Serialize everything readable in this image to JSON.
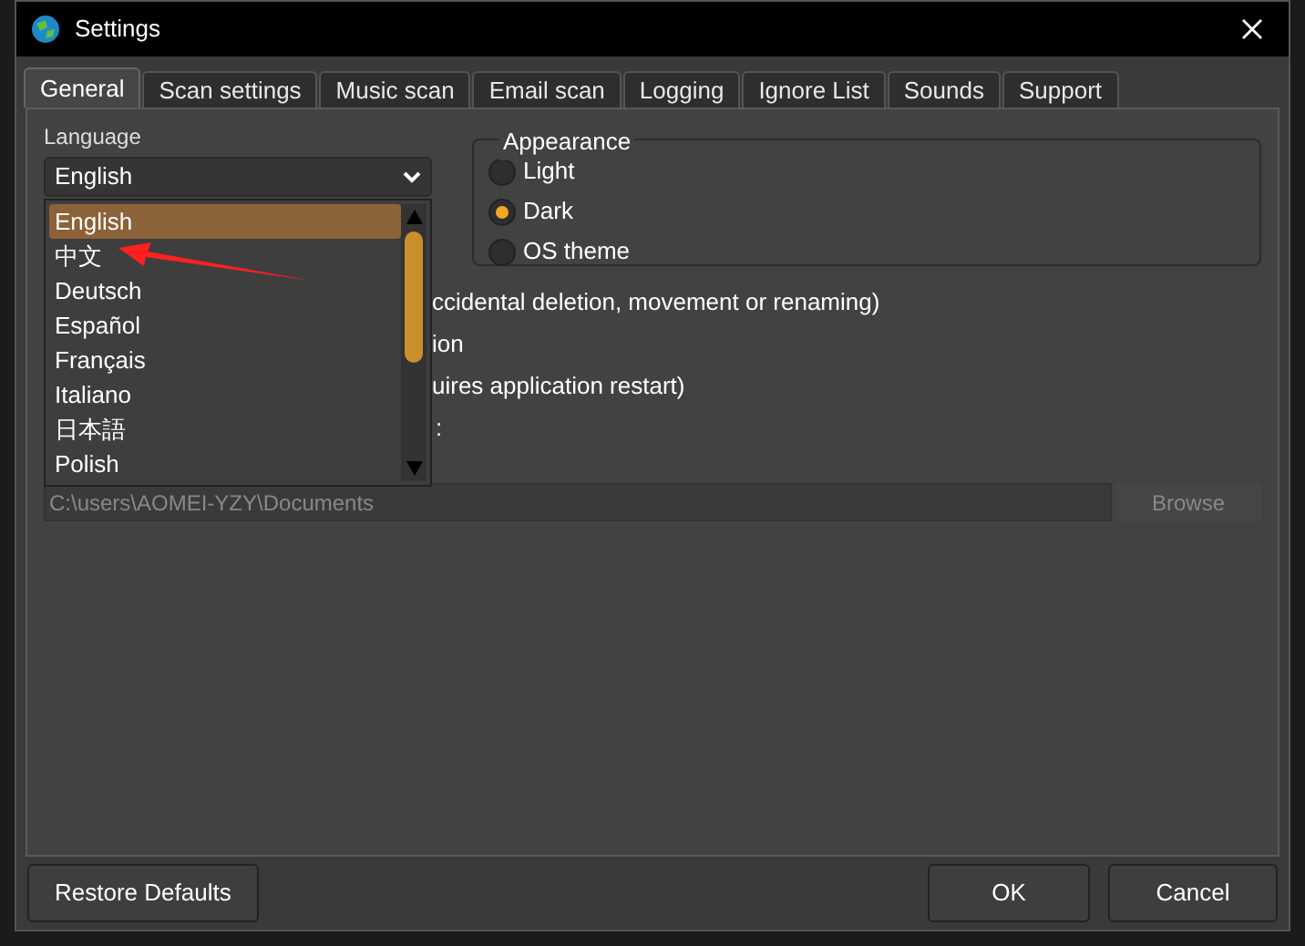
{
  "window": {
    "title": "Settings"
  },
  "tabs": [
    {
      "label": "General",
      "selected": true
    },
    {
      "label": "Scan settings",
      "selected": false
    },
    {
      "label": "Music scan",
      "selected": false
    },
    {
      "label": "Email scan",
      "selected": false
    },
    {
      "label": "Logging",
      "selected": false
    },
    {
      "label": "Ignore List",
      "selected": false
    },
    {
      "label": "Sounds",
      "selected": false
    },
    {
      "label": "Support",
      "selected": false
    }
  ],
  "language": {
    "label": "Language",
    "value": "English",
    "options": [
      {
        "label": "English",
        "selected": true
      },
      {
        "label": "中文",
        "selected": false
      },
      {
        "label": "Deutsch",
        "selected": false
      },
      {
        "label": "Español",
        "selected": false
      },
      {
        "label": "Français",
        "selected": false
      },
      {
        "label": "Italiano",
        "selected": false
      },
      {
        "label": "日本語",
        "selected": false
      },
      {
        "label": "Polish",
        "selected": false
      }
    ]
  },
  "appearance": {
    "title": "Appearance",
    "options": [
      {
        "label": "Light",
        "selected": false
      },
      {
        "label": "Dark",
        "selected": true
      },
      {
        "label": "OS theme",
        "selected": false
      }
    ]
  },
  "options": [
    "ccidental deletion, movement or renaming)",
    "ion",
    "uires application restart)"
  ],
  "folder": {
    "label": ":",
    "value": "C:\\users\\AOMEI-YZY\\Documents",
    "browse": "Browse"
  },
  "buttons": {
    "restore": "Restore Defaults",
    "ok": "OK",
    "cancel": "Cancel"
  }
}
